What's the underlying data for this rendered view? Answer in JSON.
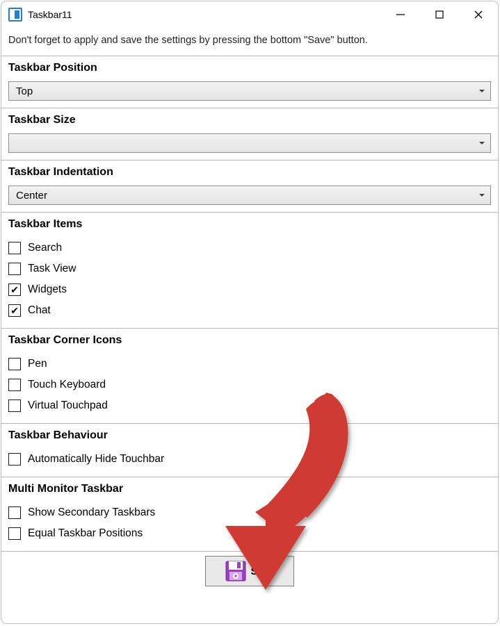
{
  "window": {
    "title": "Taskbar11"
  },
  "hint": "Don't forget to apply and save the settings by pressing the bottom \"Save\" button.",
  "sections": {
    "position": {
      "title": "Taskbar Position",
      "value": "Top"
    },
    "size": {
      "title": "Taskbar Size",
      "value": ""
    },
    "indentation": {
      "title": "Taskbar Indentation",
      "value": "Center"
    },
    "items": {
      "title": "Taskbar Items",
      "search": "Search",
      "taskview": "Task View",
      "widgets": "Widgets",
      "chat": "Chat"
    },
    "cornerIcons": {
      "title": "Taskbar Corner Icons",
      "pen": "Pen",
      "touchKeyboard": "Touch Keyboard",
      "virtualTouchpad": "Virtual Touchpad"
    },
    "behaviour": {
      "title": "Taskbar Behaviour",
      "autoHide": "Automatically Hide Touchbar"
    },
    "multiMonitor": {
      "title": "Multi Monitor Taskbar",
      "showSecondary": "Show Secondary Taskbars",
      "equalPositions": "Equal Taskbar Positions"
    }
  },
  "save": {
    "label": "Save"
  }
}
